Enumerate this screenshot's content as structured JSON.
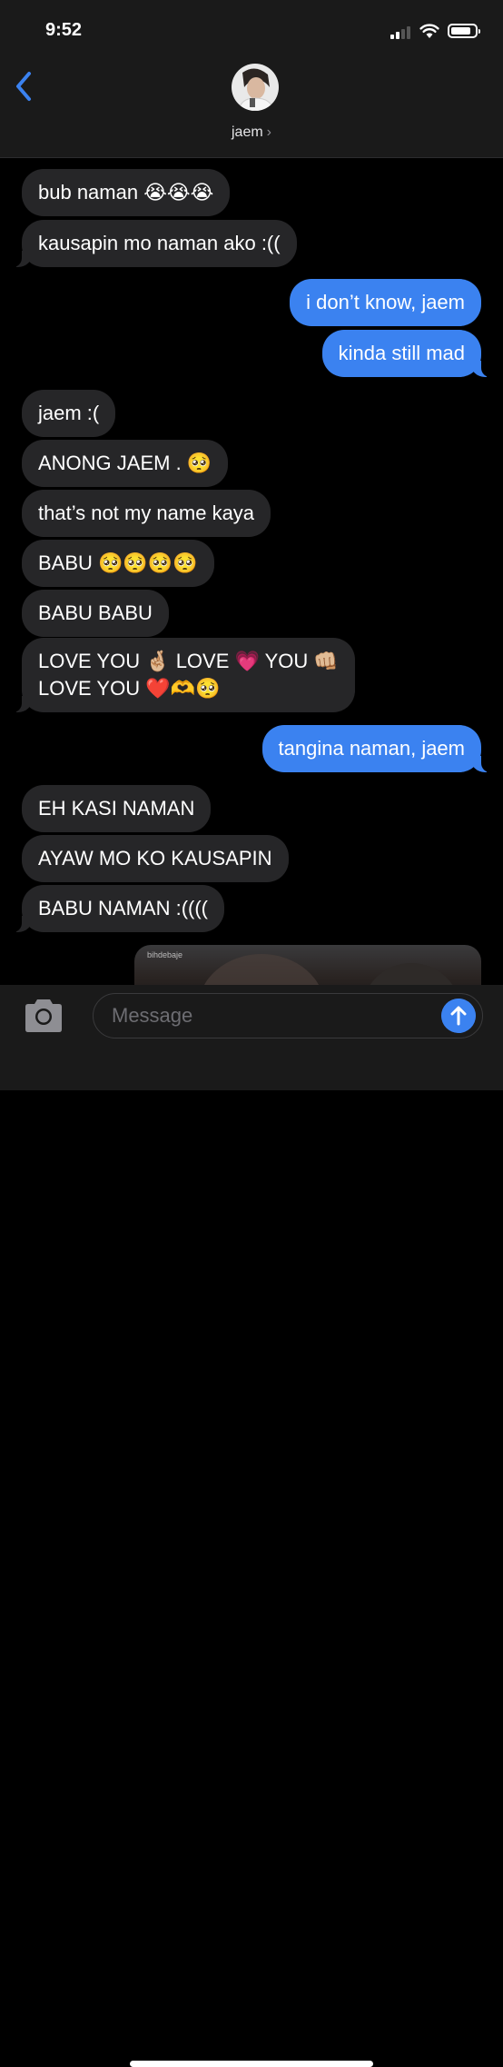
{
  "status_bar": {
    "time": "9:52",
    "battery_level": 0.85
  },
  "header": {
    "contact_name": "jaem",
    "chevron": "›",
    "back_icon": "chevron-left-icon"
  },
  "messages": [
    {
      "side": "in",
      "text": "bub naman 😭😭😭"
    },
    {
      "side": "in",
      "text": "kausapin mo naman ako :(("
    },
    {
      "side": "out",
      "text": "i don’t know, jaem"
    },
    {
      "side": "out",
      "text": "kinda still mad"
    },
    {
      "side": "in",
      "text": "jaem :("
    },
    {
      "side": "in",
      "text": "ANONG JAEM . 🥺"
    },
    {
      "side": "in",
      "text": "that’s not my name kaya"
    },
    {
      "side": "in",
      "text": "BABU 🥺🥺🥺🥺"
    },
    {
      "side": "in",
      "text": "BABU BABU"
    },
    {
      "side": "in",
      "text_line1": "LOVE YOU 🤞🏼 LOVE 💗 YOU 👊🏼",
      "text_line2": "LOVE YOU ❤️🫶🥺"
    },
    {
      "side": "out",
      "text": "tangina naman, jaem"
    },
    {
      "side": "in",
      "text": "EH KASI NAMAN"
    },
    {
      "side": "in",
      "text": "AYAW MO KO KAUSAPIN"
    },
    {
      "side": "in",
      "text": "BABU NAMAN :(((("
    }
  ],
  "image_message": {
    "watermark": "bihdebaje"
  },
  "composer": {
    "placeholder": "Message"
  },
  "colors": {
    "outgoing": "#3b82f0",
    "incoming": "#262628",
    "background": "#000000"
  }
}
